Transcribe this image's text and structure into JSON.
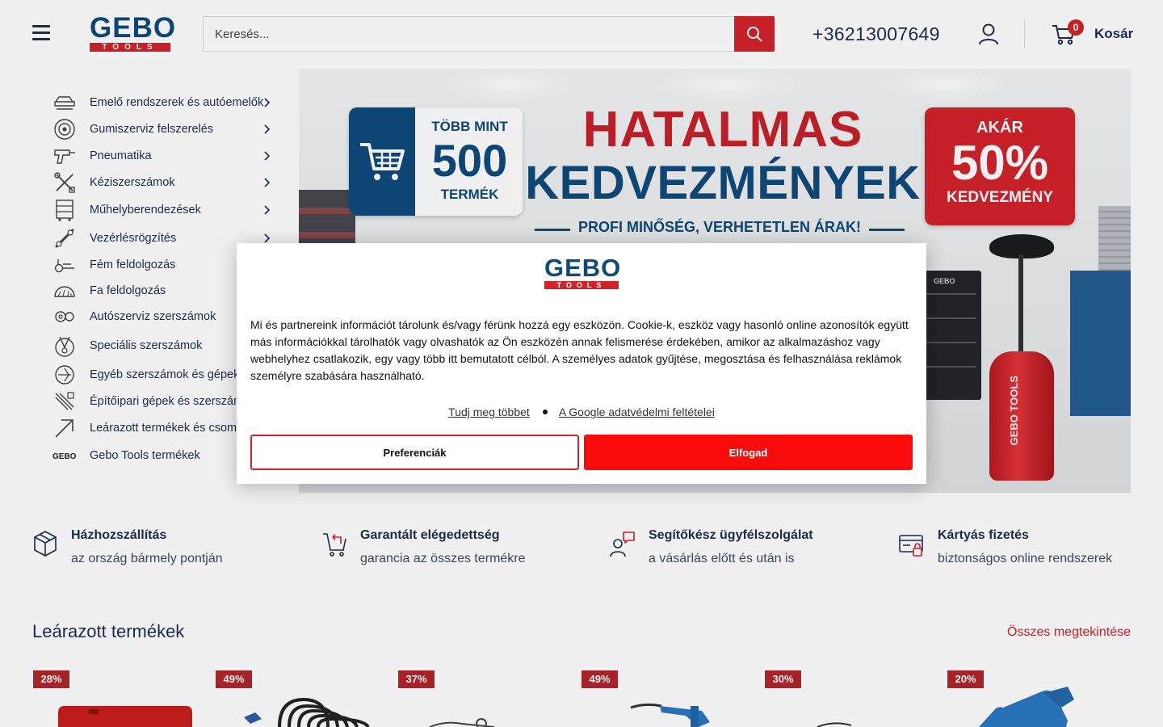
{
  "header": {
    "logo_text": "GEBO",
    "logo_sub": "TOOLS",
    "search_placeholder": "Keresés...",
    "phone": "+36213007649",
    "cart_count": "0",
    "cart_label": "Kosár"
  },
  "categories": [
    {
      "label": "Emelő rendszerek és autóemelők",
      "icon": "car-lift-icon",
      "has_submenu": true
    },
    {
      "label": "Gumiszerviz felszerelés",
      "icon": "tire-icon",
      "has_submenu": true
    },
    {
      "label": "Pneumatika",
      "icon": "air-gun-icon",
      "has_submenu": true
    },
    {
      "label": "Kéziszerszámok",
      "icon": "hand-tools-icon",
      "has_submenu": true
    },
    {
      "label": "Műhelyberendezések",
      "icon": "tool-cabinet-icon",
      "has_submenu": true
    },
    {
      "label": "Vezérlésrögzítés",
      "icon": "timing-lock-icon",
      "has_submenu": true
    },
    {
      "label": "Fém feldolgozás",
      "icon": "metal-icon",
      "has_submenu": false
    },
    {
      "label": "Fa feldolgozás",
      "icon": "saw-blade-icon",
      "has_submenu": false
    },
    {
      "label": "Autószerviz szerszámok",
      "icon": "gears-icon",
      "has_submenu": false
    },
    {
      "label": "Speciális szerszámok",
      "icon": "special-tools-icon",
      "has_submenu": false
    },
    {
      "label": "Egyéb szerszámok és gépek",
      "icon": "other-tools-icon",
      "has_submenu": false
    },
    {
      "label": "Építőipari gépek és szerszámok",
      "icon": "construction-icon",
      "has_submenu": false
    },
    {
      "label": "Leárazott termékek és csomagok",
      "icon": "discount-arrow-icon",
      "has_submenu": false
    },
    {
      "label": "Gebo Tools termékek",
      "icon": "gebo-brand-icon",
      "has_submenu": false
    }
  ],
  "hero": {
    "badge_left_top": "TÖBB MINT",
    "badge_left_num": "500",
    "badge_left_bottom": "TERMÉK",
    "headline_1": "HATALMAS",
    "headline_2": "KEDVEZMÉNYEK",
    "tagline": "PROFI MINŐSÉG, VERHETETLEN ÁRAK!",
    "badge_right_top": "AKÁR",
    "badge_right_num": "50%",
    "badge_right_bottom": "KEDVEZMÉNY",
    "tank_label": "GEBO TOOLS",
    "cabinet_label": "GEBO"
  },
  "cookie": {
    "logo_text": "GEBO",
    "logo_sub": "TOOLS",
    "text": "Mi és partnereink információt tárolunk és/vagy férünk hozzá egy eszközön. Cookie-k, eszköz vagy hasonló online azonosítók együtt más információkkal tárolhatók vagy olvashatók az Ön eszközén annak felismerése érdekében, amikor az alkalmazáshoz vagy webhelyhez csatlakozik, egy vagy több itt bemutatott célból. A személyes adatok gyűjtése, megosztása és felhasználása reklámok személyre szabására használható.",
    "link_more": "Tudj meg többet",
    "link_google": "A Google adatvédelmi feltételei",
    "btn_preferences": "Preferenciák",
    "btn_accept": "Elfogad"
  },
  "features": [
    {
      "title": "Házhozszállítás",
      "subtitle": "az ország bármely pontján",
      "icon": "package-icon"
    },
    {
      "title": "Garantált elégedettség",
      "subtitle": "garancia az összes termékre",
      "icon": "cart-return-icon"
    },
    {
      "title": "Segítőkész ügyfélszolgálat",
      "subtitle": "a vásárlás előtt és után is",
      "icon": "support-chat-icon"
    },
    {
      "title": "Kártyás fizetés",
      "subtitle": "biztonságos online rendszerek",
      "icon": "secure-card-icon"
    }
  ],
  "discounted": {
    "title": "Leárazott termékek",
    "view_all": "Összes megtekintése",
    "products": [
      {
        "badge": "28%"
      },
      {
        "badge": "49%"
      },
      {
        "badge": "37%"
      },
      {
        "badge": "49%"
      },
      {
        "badge": "30%"
      },
      {
        "badge": "20%"
      }
    ]
  },
  "colors": {
    "brand_blue": "#0e4a7c",
    "brand_red": "#d2232a",
    "accept_red": "#f90b0b",
    "text_navy": "#1e2d4f"
  }
}
